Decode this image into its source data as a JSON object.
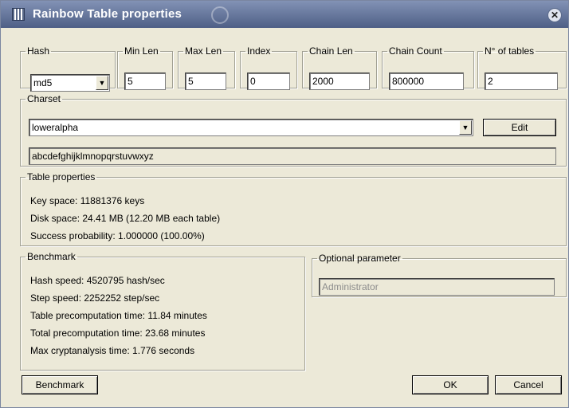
{
  "window": {
    "title": "Rainbow Table properties"
  },
  "params": {
    "hash": {
      "label": "Hash",
      "value": "md5"
    },
    "min_len": {
      "label": "Min Len",
      "value": "5"
    },
    "max_len": {
      "label": "Max Len",
      "value": "5"
    },
    "index": {
      "label": "Index",
      "value": "0"
    },
    "chain_len": {
      "label": "Chain Len",
      "value": "2000"
    },
    "chain_count": {
      "label": "Chain Count",
      "value": "800000"
    },
    "num_tables": {
      "label": "N° of tables",
      "value": "2"
    }
  },
  "charset": {
    "label": "Charset",
    "selected": "loweralpha",
    "edit_label": "Edit",
    "characters": "abcdefghijklmnopqrstuvwxyz"
  },
  "table_properties": {
    "label": "Table properties",
    "lines": [
      "Key space: 11881376 keys",
      "Disk space: 24.41 MB (12.20 MB each table)",
      "Success probability: 1.000000 (100.00%)"
    ]
  },
  "benchmark": {
    "label": "Benchmark",
    "lines": [
      "Hash speed: 4520795 hash/sec",
      "Step speed: 2252252 step/sec",
      "Table precomputation time: 11.84 minutes",
      "Total precomputation time: 23.68 minutes",
      "Max cryptanalysis time: 1.776 seconds"
    ]
  },
  "optional": {
    "label": "Optional parameter",
    "value": "Administrator"
  },
  "buttons": {
    "benchmark": "Benchmark",
    "ok": "OK",
    "cancel": "Cancel"
  },
  "icons": {
    "title": "table-icon",
    "swirl": "swirl-logo-icon",
    "close": "close-icon",
    "dropdown": "chevron-down-icon"
  }
}
